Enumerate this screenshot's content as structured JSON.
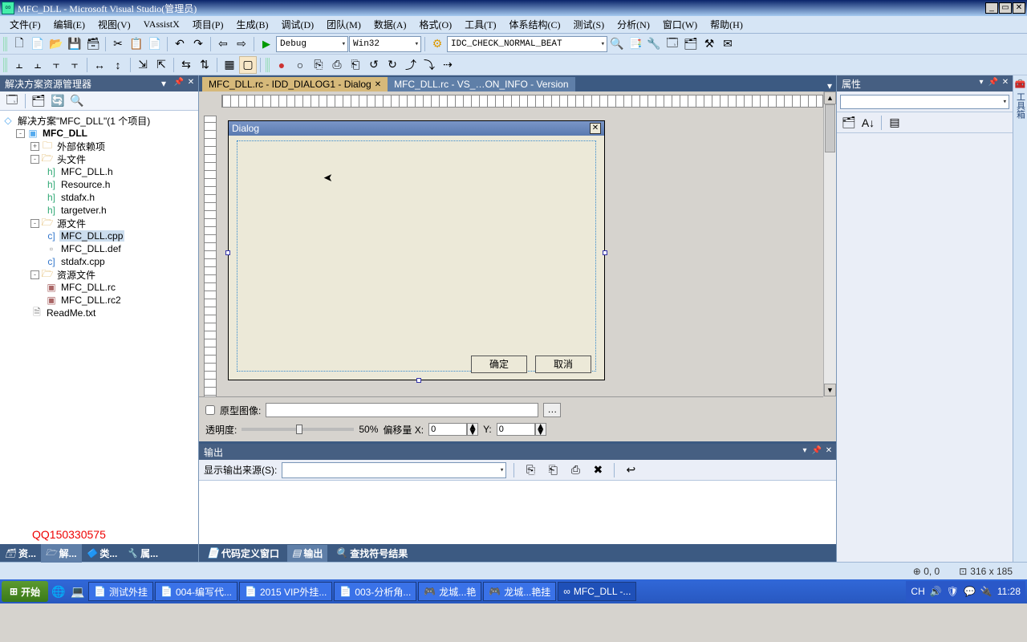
{
  "title": "MFC_DLL - Microsoft Visual Studio(管理员)",
  "menu": [
    "文件(F)",
    "编辑(E)",
    "视图(V)",
    "VAssistX",
    "项目(P)",
    "生成(B)",
    "调试(D)",
    "团队(M)",
    "数据(A)",
    "格式(O)",
    "工具(T)",
    "体系结构(C)",
    "测试(S)",
    "分析(N)",
    "窗口(W)",
    "帮助(H)"
  ],
  "toolbar1": {
    "config": "Debug",
    "platform": "Win32",
    "find": "IDC_CHECK_NORMAL_BEAT"
  },
  "left": {
    "title": "解决方案资源管理器",
    "solution": "解决方案\"MFC_DLL\"(1 个项目)",
    "project": "MFC_DLL",
    "folders": {
      "ext": "外部依赖项",
      "headers": "头文件",
      "src": "源文件",
      "res": "资源文件"
    },
    "h": [
      "MFC_DLL.h",
      "Resource.h",
      "stdafx.h",
      "targetver.h"
    ],
    "cpp": [
      "MFC_DLL.cpp",
      "MFC_DLL.def",
      "stdafx.cpp"
    ],
    "rc": [
      "MFC_DLL.rc",
      "MFC_DLL.rc2"
    ],
    "readme": "ReadMe.txt",
    "watermark": "QQ150330575",
    "tabs": [
      "资...",
      "解...",
      "类...",
      "属..."
    ]
  },
  "docs": {
    "active": "MFC_DLL.rc - IDD_DIALOG1 - Dialog",
    "inactive": "MFC_DLL.rc - VS_…ON_INFO - Version"
  },
  "dialog": {
    "title": "Dialog",
    "ok": "确定",
    "cancel": "取消"
  },
  "bottom": {
    "proto": "原型图像:",
    "trans": "透明度:",
    "pct": "50%",
    "offx": "偏移量 X:",
    "offy": "Y:",
    "x": "0",
    "y": "0"
  },
  "output": {
    "title": "输出",
    "srclabel": "显示输出来源(S):",
    "tabs": [
      "代码定义窗口",
      "输出",
      "查找符号结果"
    ]
  },
  "right": {
    "title": "属性"
  },
  "status": {
    "pos": "0, 0",
    "dims": "316 x 185"
  },
  "taskbar": {
    "start": "开始",
    "items": [
      "测试外挂",
      "004-编写代...",
      "2015 VIP外挂...",
      "003-分析角...",
      "龙城...艳",
      "龙城...艳挂",
      "MFC_DLL -..."
    ],
    "lang": "CH",
    "time": "11:28"
  }
}
